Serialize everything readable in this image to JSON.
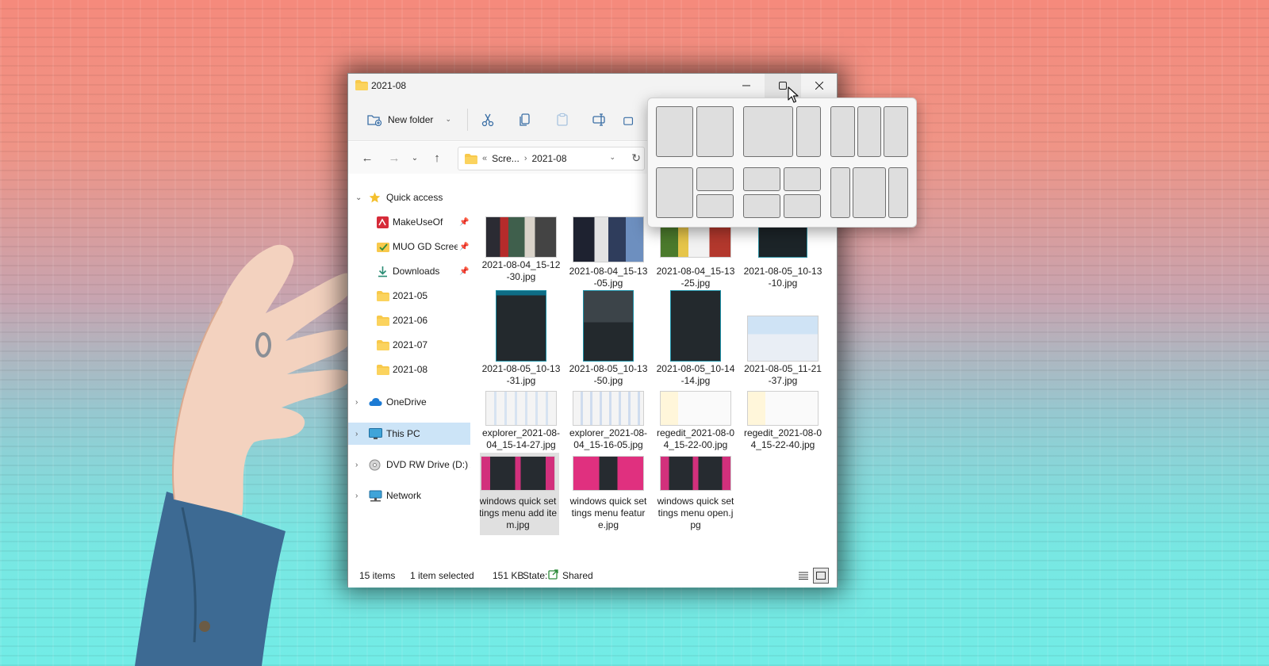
{
  "window": {
    "title": "2021-08",
    "controls": {
      "minimize": "minimize",
      "maximize": "maximize",
      "close": "close"
    }
  },
  "toolbar": {
    "new_folder_label": "New folder",
    "buttons": [
      "cut-icon",
      "copy-icon",
      "paste-icon",
      "rename-icon",
      "share-icon"
    ]
  },
  "address": {
    "overflow": "«",
    "crumbs": [
      "Scre...",
      "2021-08"
    ]
  },
  "sidebar": {
    "items": [
      {
        "label": "Quick access",
        "icon": "star-icon"
      },
      {
        "label": "MakeUseOf",
        "icon": "muo-app-icon",
        "pinned": true
      },
      {
        "label": "MUO GD Screen",
        "icon": "folder-check-icon",
        "pinned": true
      },
      {
        "label": "Downloads",
        "icon": "download-icon",
        "pinned": true
      },
      {
        "label": "2021-05",
        "icon": "folder-icon"
      },
      {
        "label": "2021-06",
        "icon": "folder-icon"
      },
      {
        "label": "2021-07",
        "icon": "folder-icon"
      },
      {
        "label": "2021-08",
        "icon": "folder-icon"
      },
      {
        "label": "OneDrive",
        "icon": "cloud-icon"
      },
      {
        "label": "This PC",
        "icon": "monitor-icon",
        "selected": true
      },
      {
        "label": "DVD RW Drive (D:) A",
        "icon": "disc-icon"
      },
      {
        "label": "Network",
        "icon": "network-icon"
      }
    ]
  },
  "files": [
    {
      "name": "2021-08-04_15-12-30.jpg"
    },
    {
      "name": "2021-08-04_15-13-05.jpg"
    },
    {
      "name": "2021-08-04_15-13-25.jpg"
    },
    {
      "name": "2021-08-05_10-13-10.jpg"
    },
    {
      "name": "2021-08-05_10-13-31.jpg"
    },
    {
      "name": "2021-08-05_10-13-50.jpg"
    },
    {
      "name": "2021-08-05_10-14-14.jpg"
    },
    {
      "name": "2021-08-05_11-21-37.jpg"
    },
    {
      "name": "explorer_2021-08-04_15-14-27.jpg"
    },
    {
      "name": "explorer_2021-08-04_15-16-05.jpg"
    },
    {
      "name": "regedit_2021-08-04_15-22-00.jpg"
    },
    {
      "name": "regedit_2021-08-04_15-22-40.jpg"
    },
    {
      "name": "windows quick settings menu add item.jpg",
      "selected": true
    },
    {
      "name": "windows quick settings menu feature.jpg"
    },
    {
      "name": "windows quick settings menu open.jpg"
    }
  ],
  "status": {
    "items": "15 items",
    "selected": "1 item selected",
    "size": "151 KB",
    "state_label": "State:",
    "state_value": "Shared"
  },
  "snap_layouts": [
    "two-equal",
    "two-wide-left",
    "three-columns",
    "main-plus-two",
    "four-grid",
    "three-wide-center"
  ],
  "colors": {
    "accent": "#0067c0",
    "selection": "#cce4f7",
    "folder": "#f8c94b"
  }
}
